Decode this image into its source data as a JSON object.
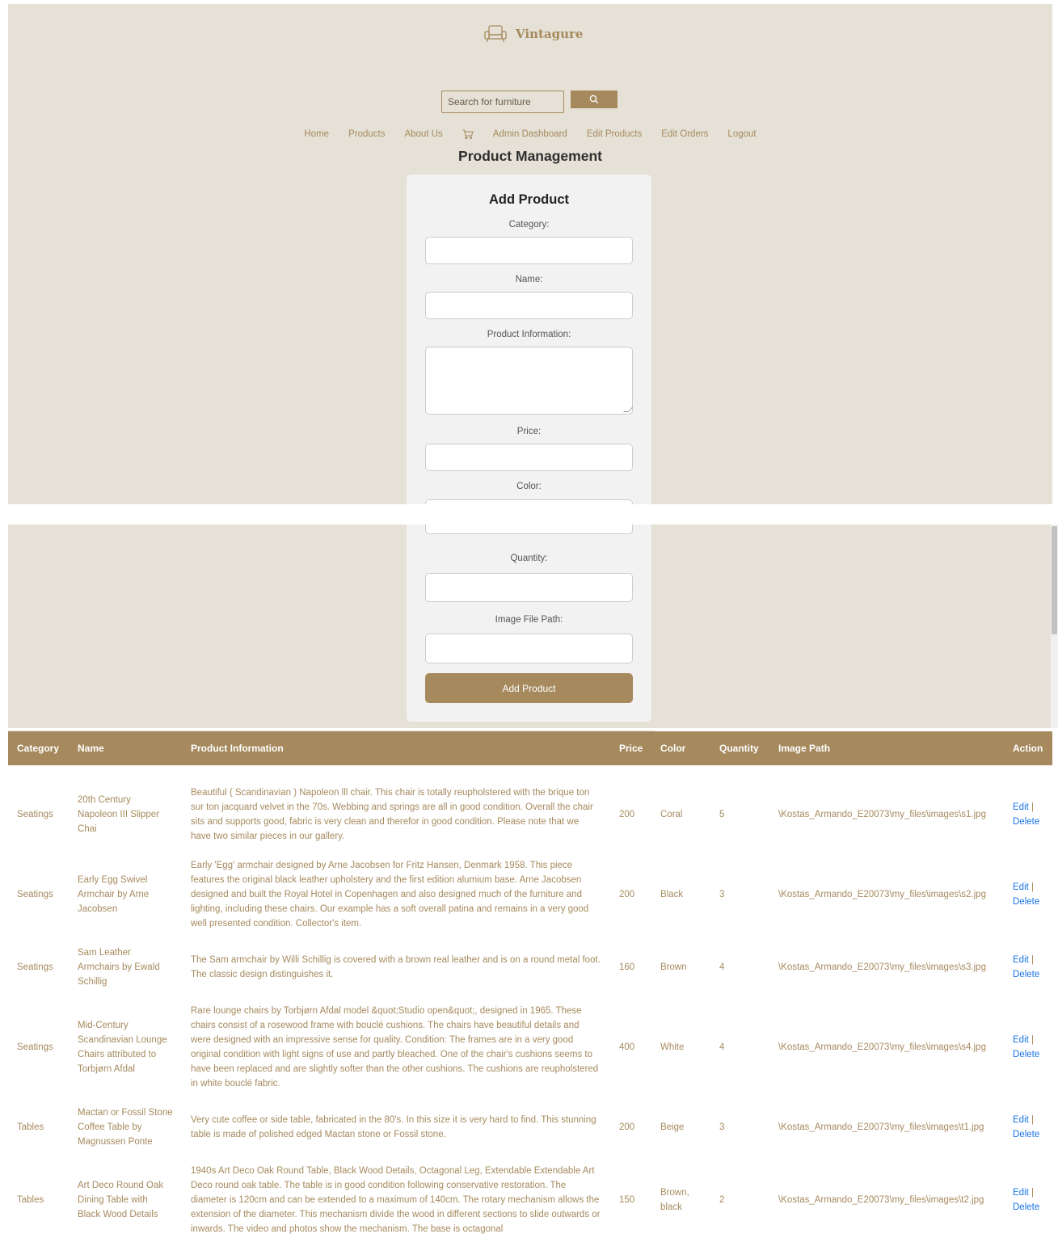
{
  "brand": {
    "name": "Vintagure"
  },
  "search": {
    "placeholder": "Search for furniture"
  },
  "nav": {
    "items": [
      "Home",
      "Products",
      "About Us",
      "Admin Dashboard",
      "Edit Products",
      "Edit Orders",
      "Logout"
    ]
  },
  "page": {
    "title": "Product Management"
  },
  "form": {
    "title": "Add Product",
    "labels": {
      "category": "Category:",
      "name": "Name:",
      "info": "Product Information:",
      "price": "Price:",
      "color": "Color:",
      "quantity": "Quantity:",
      "image": "Image File Path:"
    },
    "submit_label": "Add Product"
  },
  "table": {
    "headers": [
      "Category",
      "Name",
      "Product Information",
      "Price",
      "Color",
      "Quantity",
      "Image Path",
      "Action"
    ],
    "edit_label": "Edit",
    "delete_label": "Delete",
    "rows": [
      {
        "category": "Seatings",
        "name": "20th Century Napoleon III Slipper Chai",
        "info": "Beautiful ( Scandinavian ) Napoleon lll chair. This chair is totally reupholstered with the brique ton sur ton jacquard velvet in the 70s. Webbing and springs are all in good condition. Overall the chair sits and supports good, fabric is very clean and therefor in good condition. Please note that we have two similar pieces in our gallery.",
        "price": "200",
        "color": "Coral",
        "quantity": "5",
        "image": "\\Kostas_Armando_E20073\\my_files\\images\\s1.jpg"
      },
      {
        "category": "Seatings",
        "name": "Early Egg Swivel Armchair by Arne Jacobsen",
        "info": "Early 'Egg' armchair designed by Arne Jacobsen for Fritz Hansen, Denmark 1958. This piece features the original black leather upholstery and the first edition alumium base. Arne Jacobsen designed and built the Royal Hotel in Copenhagen and also designed much of the furniture and lighting, including these chairs. Our example has a soft overall patina and remains in a very good well presented condition. Collector's item.",
        "price": "200",
        "color": "Black",
        "quantity": "3",
        "image": "\\Kostas_Armando_E20073\\my_files\\images\\s2.jpg"
      },
      {
        "category": "Seatings",
        "name": "Sam Leather Armchairs by Ewald Schillig",
        "info": "The Sam armchair by Willi Schillig is covered with a brown real leather and is on a round metal foot. The classic design distinguishes it.",
        "price": "160",
        "color": "Brown",
        "quantity": "4",
        "image": "\\Kostas_Armando_E20073\\my_files\\images\\s3.jpg"
      },
      {
        "category": "Seatings",
        "name": "Mid-Century Scandinavian Lounge Chairs attributed to Torbjørn Afdal",
        "info": "Rare lounge chairs by Torbjørn Afdal model &quot;Studio open&quot;, designed in 1965. These chairs consist of a rosewood frame with bouclé cushions. The chairs have beautiful details and were designed with an impressive sense for quality. Condition: The frames are in a very good original condition with light signs of use and partly bleached. One of the chair's cushions seems to have been replaced and are slightly softer than the other cushions. The cushions are reupholstered in white bouclé fabric.",
        "price": "400",
        "color": "White",
        "quantity": "4",
        "image": "\\Kostas_Armando_E20073\\my_files\\images\\s4.jpg"
      },
      {
        "category": "Tables",
        "name": "Mactan or Fossil Stone Coffee Table by Magnussen Ponte",
        "info": "Very cute coffee or side table, fabricated in the 80's. In this size it is very hard to find. This stunning table is made of polished edged Mactan stone or Fossil stone.",
        "price": "200",
        "color": "Beige",
        "quantity": "3",
        "image": "\\Kostas_Armando_E20073\\my_files\\images\\t1.jpg"
      },
      {
        "category": "Tables",
        "name": "Art Deco Round Oak Dining Table with Black Wood Details",
        "info": "1940s Art Deco Oak Round Table, Black Wood Details, Octagonal Leg, Extendable Extendable Art Deco round oak table. The table is in good condition following conservative restoration. The diameter is 120cm and can be extended to a maximum of 140cm. The rotary mechanism allows the extension of the diameter. This mechanism divide the wood in different sections to slide outwards or inwards. The video and photos show the mechanism. The base is octagonal",
        "price": "150",
        "color": "Brown, black",
        "quantity": "2",
        "image": "\\Kostas_Armando_E20073\\my_files\\images\\t2.jpg"
      }
    ]
  }
}
